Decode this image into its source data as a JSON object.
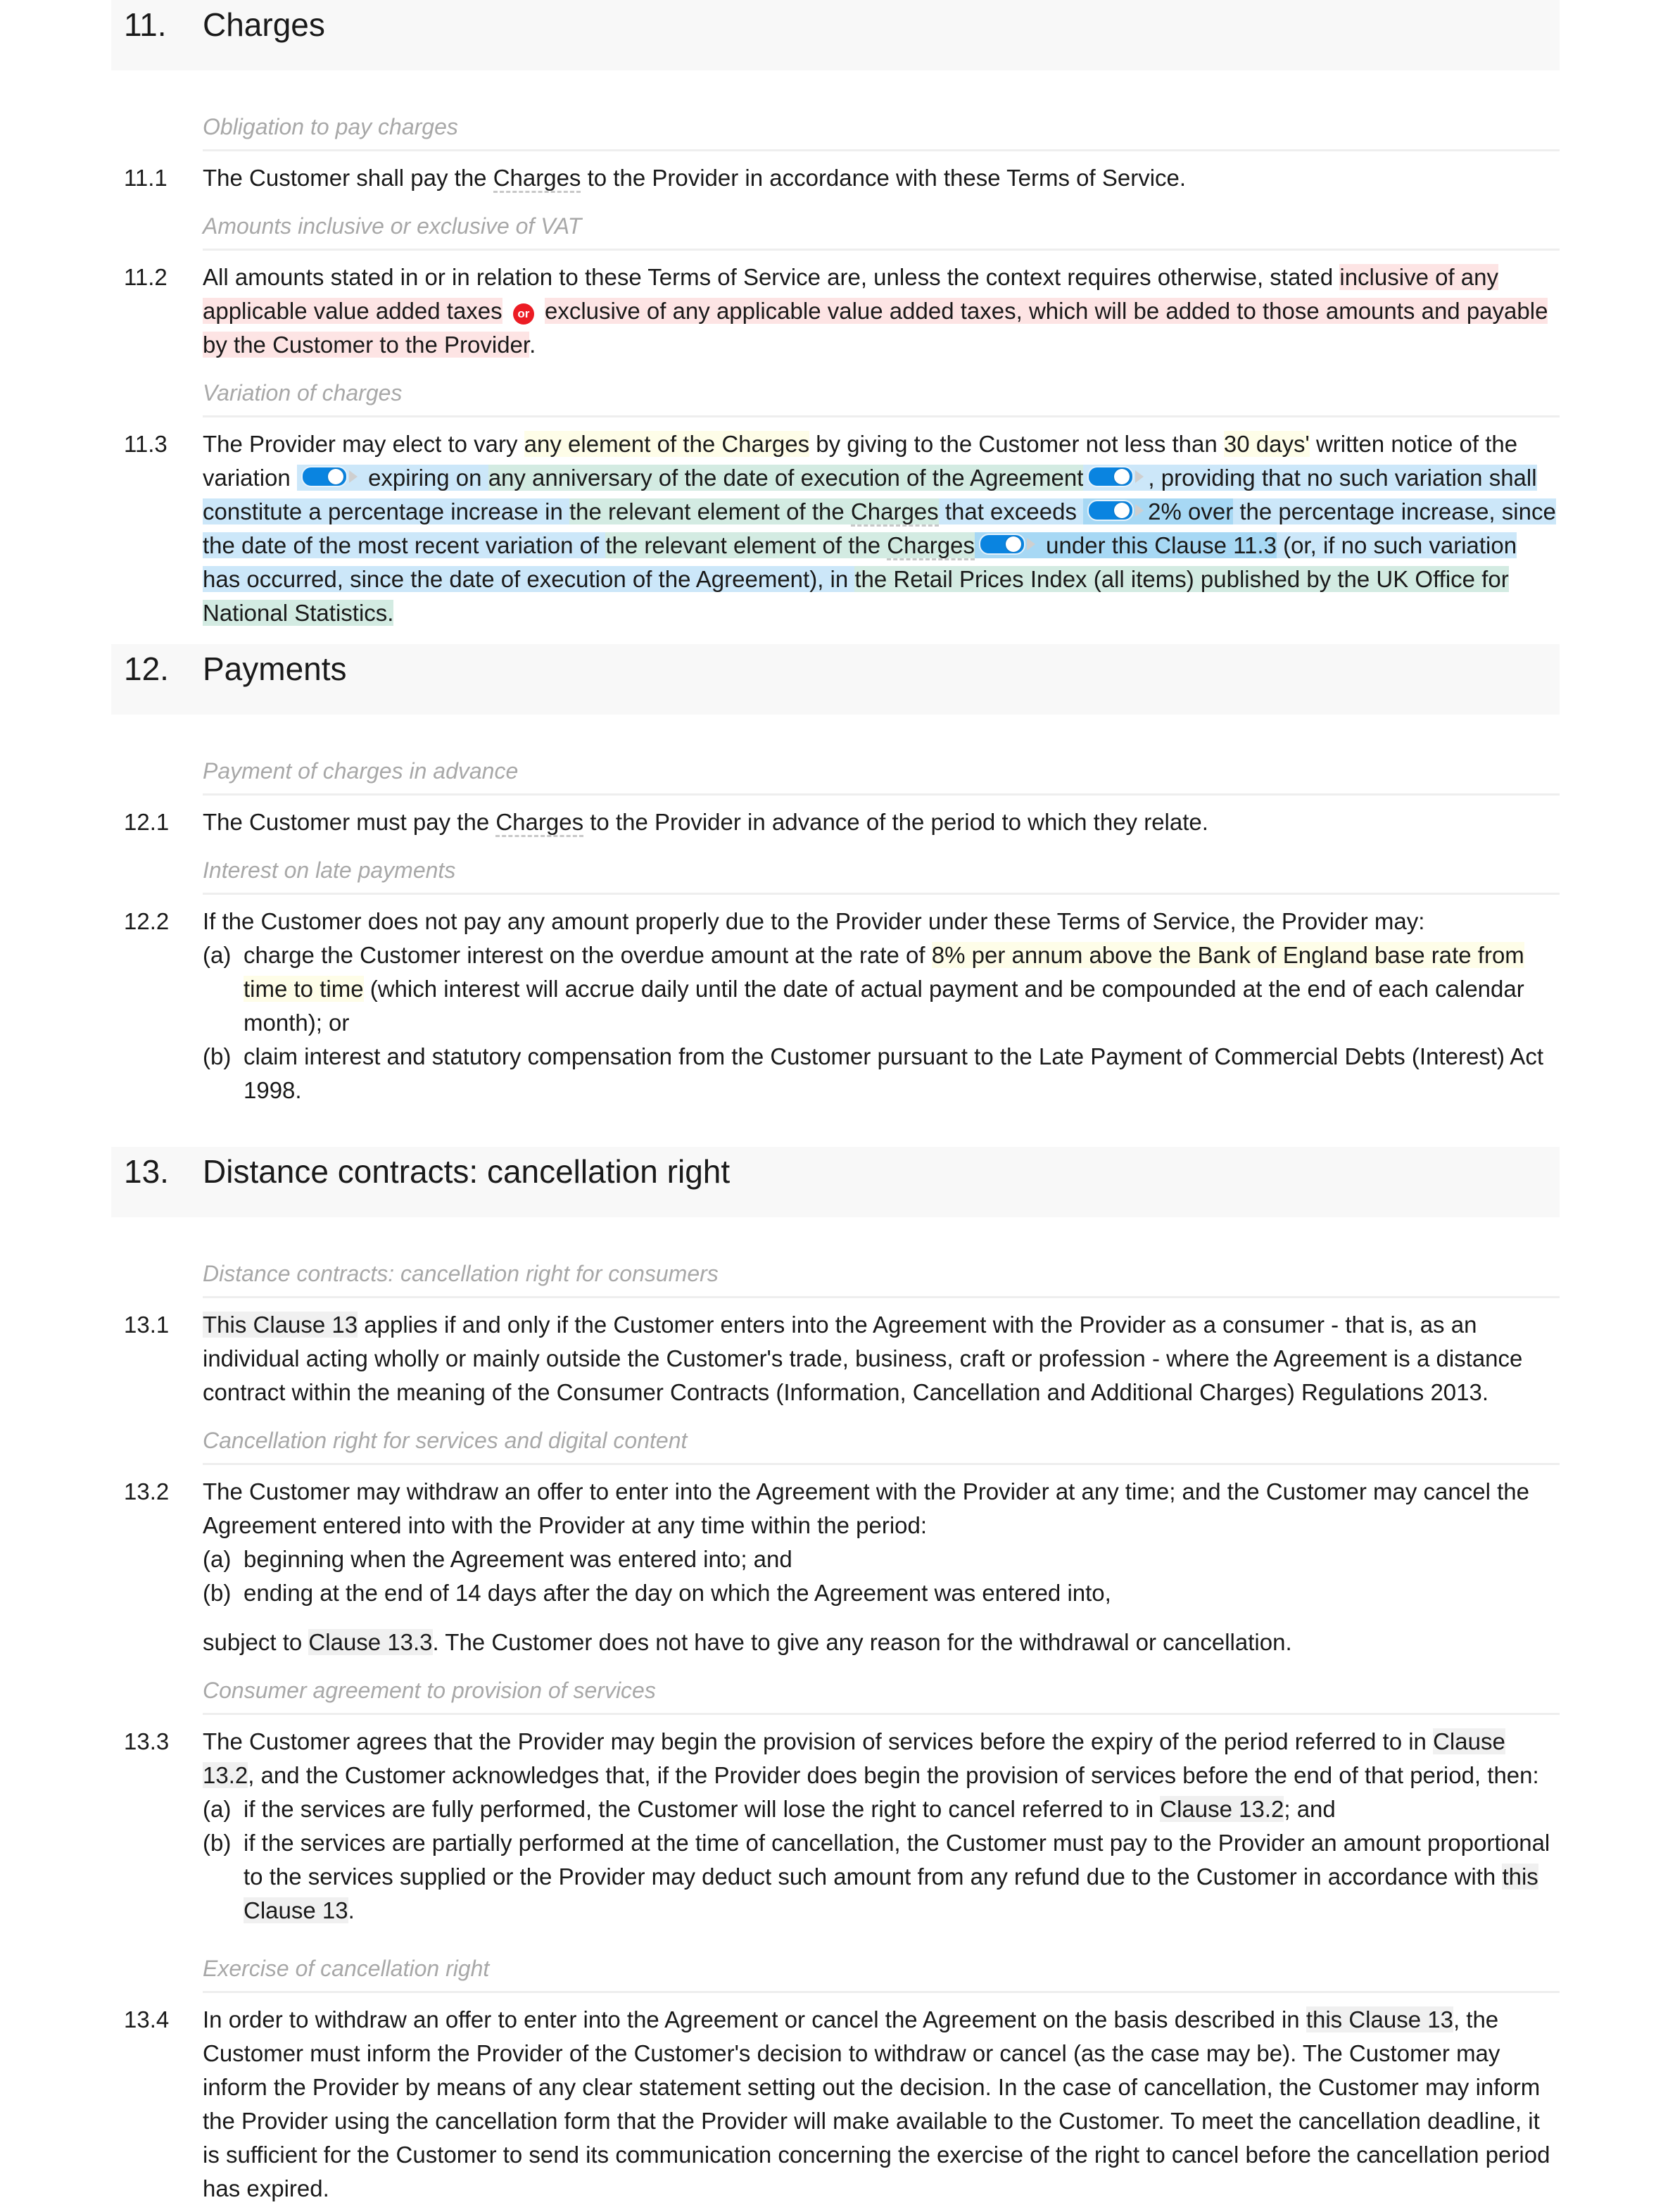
{
  "sections": [
    {
      "number": "11.",
      "title": "Charges",
      "subheadings": [
        "Obligation to pay charges",
        "Amounts inclusive or exclusive of VAT",
        "Variation of charges"
      ],
      "clauses": {
        "c1": {
          "number": "11.1",
          "t1": "The Customer shall pay the ",
          "term": "Charges",
          "t2": " to the Provider in accordance with these Terms of Service."
        },
        "c2": {
          "number": "11.2",
          "t1": "All amounts stated in or in relation to these Terms of Service are, unless the context requires otherwise, stated ",
          "opt1": "inclusive of any applicable value added taxes",
          "or_label": "or",
          "opt2": "exclusive of any applicable value added taxes, which will be added to those amounts and payable by the Customer to the Provider",
          "t2": "."
        },
        "c3": {
          "number": "11.3",
          "t1": "The Provider may elect to vary ",
          "v1": "any element of the Charges",
          "t2": " by giving to the Customer not less than ",
          "v2": "30 days'",
          "t3": " written notice of the variation ",
          "b1": " expiring on ",
          "g1": "any anniversary of the date of execution of the Agreement",
          "b2": ", providing that no such variation shall constitute a percentage increase in ",
          "g2a": "the relevant element of the ",
          "g2term": "Charges",
          "b3": " that exceeds ",
          "d1": "2% over",
          "b4": " the percentage increase, since the date of the most recent variation of ",
          "g3a": "the relevant element of the ",
          "g3term": "Charges",
          "d2": " under this",
          "ref": "Clause 11.3",
          "b5": " (or, if no such variation has occurred, since the date of execution of the Agreement), in ",
          "g4": "the Retail Prices Index (all items) published by the UK Office for National Statistics."
        }
      }
    },
    {
      "number": "12.",
      "title": "Payments",
      "subheadings": [
        "Payment of charges in advance",
        "Interest on late payments"
      ],
      "clauses": {
        "c1": {
          "number": "12.1",
          "t1": "The Customer must pay the ",
          "term": "Charges",
          "t2": " to the Provider in advance of the period to which they relate."
        },
        "c2": {
          "number": "12.2",
          "t1": "If the Customer does not pay any amount properly due to the Provider under these Terms of Service, the Provider may:",
          "items": [
            {
              "label": "(a)",
              "t1": "charge the Customer interest on the overdue amount at the rate of ",
              "v1": "8% per annum above the Bank of England base rate from time to time",
              "t2": " (which interest will accrue daily until the date of actual payment and be compounded at the end of each calendar month); or"
            },
            {
              "label": "(b)",
              "t1": "claim interest and statutory compensation from the Customer pursuant to the Late Payment of Commercial Debts (Interest) Act 1998."
            }
          ]
        }
      }
    },
    {
      "number": "13.",
      "title": "Distance contracts: cancellation right",
      "subheadings": [
        "Distance contracts: cancellation right for consumers",
        "Cancellation right for services and digital content",
        "Consumer agreement to provision of services",
        "Exercise of cancellation right"
      ],
      "clauses": {
        "c1": {
          "number": "13.1",
          "ref": "This Clause 13",
          "t1": " applies if and only if the Customer enters into the Agreement with the Provider as a consumer - that is, as an individual acting wholly or mainly outside the Customer's trade, business, craft or profession - where the Agreement is a distance contract within the meaning of the Consumer Contracts (Information, Cancellation and Additional Charges) Regulations 2013."
        },
        "c2": {
          "number": "13.2",
          "t1": "The Customer may withdraw an offer to enter into the Agreement with the Provider at any time; and the Customer may cancel the Agreement entered into with the Provider at any time within the period:",
          "items": [
            {
              "label": "(a)",
              "t1": "beginning when the Agreement was entered into; and"
            },
            {
              "label": "(b)",
              "t1": "ending at the end of 14 days after the day on which the Agreement was entered into,"
            }
          ],
          "after_t1": "subject to ",
          "after_ref": "Clause 13.3",
          "after_t2": ". The Customer does not have to give any reason for the withdrawal or cancellation."
        },
        "c3": {
          "number": "13.3",
          "t1": "The Customer agrees that the Provider may begin the provision of services before the expiry of the period referred to in ",
          "ref": "Clause 13.2",
          "t2": ", and the Customer acknowledges that, if the Provider does begin the provision of services before the end of that period, then:",
          "items": [
            {
              "label": "(a)",
              "t1": "if the services are fully performed, the Customer will lose the right to cancel referred to in ",
              "ref": "Clause 13.2",
              "t2": "; and"
            },
            {
              "label": "(b)",
              "t1": "if the services are partially performed at the time of cancellation, the Customer must pay to the Provider an amount proportional to the services supplied or the Provider may deduct such amount from any refund due to the Customer in accordance with ",
              "ref": "this Clause 13",
              "t2": "."
            }
          ]
        },
        "c4": {
          "number": "13.4",
          "t1": "In order to withdraw an offer to enter into the Agreement or cancel the Agreement on the basis described in ",
          "ref": "this Clause 13",
          "t2": ", the Customer must inform the Provider of the Customer's decision to withdraw or cancel (as the case may be). The Customer may inform the Provider by means of any clear statement setting out the decision. In the case of cancellation, the Customer may inform the Provider using the cancellation form that the Provider will make available to the Customer. To meet the cancellation deadline, it is sufficient for the Customer to send its communication concerning the exercise of the right to cancel before the cancellation period has expired."
        }
      }
    }
  ],
  "colors": {
    "option_red": "#fde4e4",
    "variable_yellow": "#fefde8",
    "optional_blue": "#cce7f9",
    "nested_green": "#d3ebe2",
    "toggle_blue": "#0a84e0",
    "or_badge_red": "#ec1c24"
  },
  "toggles": {
    "t1": "on",
    "t2": "on",
    "t3": "on",
    "t4": "on"
  }
}
